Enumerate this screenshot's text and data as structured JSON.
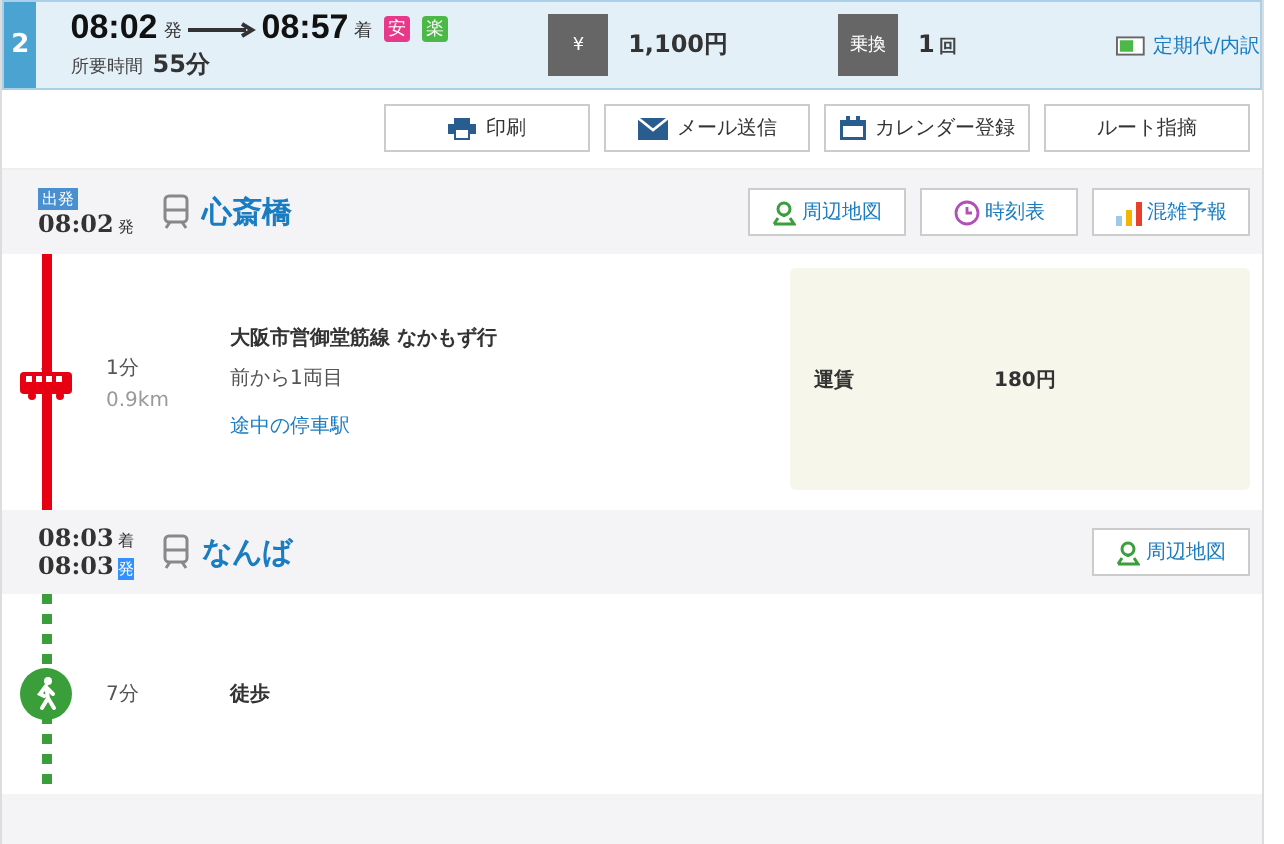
{
  "route": {
    "number": "2",
    "depart_time": "08:02",
    "depart_suffix": "発",
    "arrive_time": "08:57",
    "arrive_suffix": "着",
    "badges": [
      {
        "label": "安",
        "color": "#e8388a"
      },
      {
        "label": "楽",
        "color": "#4cb848"
      }
    ],
    "duration_label": "所要時間",
    "duration": "55分",
    "fare_icon": "¥",
    "fare": "1,100円",
    "transfer_icon": "乗換",
    "transfers": "1",
    "transfers_unit": "回",
    "commuter_link": "定期代/内訳"
  },
  "actions": [
    {
      "kind": "print",
      "label": "印刷"
    },
    {
      "kind": "mail",
      "label": "メール送信"
    },
    {
      "kind": "calendar",
      "label": "カレンダー登録"
    },
    {
      "kind": "report",
      "label": "ルート指摘"
    }
  ],
  "stops": [
    {
      "badge": "出発",
      "times": [
        {
          "time": "08:02",
          "suffix": "発",
          "highlighted": false
        }
      ],
      "name": "心斎橋",
      "buttons": [
        {
          "kind": "map",
          "label": "周辺地図"
        },
        {
          "kind": "timetable",
          "label": "時刻表"
        },
        {
          "kind": "congestion",
          "label": "混雑予報"
        }
      ]
    },
    {
      "times": [
        {
          "time": "08:03",
          "suffix": "着",
          "highlighted": false
        },
        {
          "time": "08:03",
          "suffix": "発",
          "highlighted": true
        }
      ],
      "name": "なんば",
      "buttons": [
        {
          "kind": "map",
          "label": "周辺地図"
        }
      ]
    }
  ],
  "segments": [
    {
      "kind": "train",
      "duration": "1分",
      "distance": "0.9km",
      "line": "大阪市営御堂筋線 なかもず行",
      "car": "前から1両目",
      "stops_link": "途中の停車駅",
      "fare_label": "運賃",
      "fare": "180円"
    },
    {
      "kind": "walk",
      "duration": "7分",
      "line": "徒歩"
    }
  ]
}
